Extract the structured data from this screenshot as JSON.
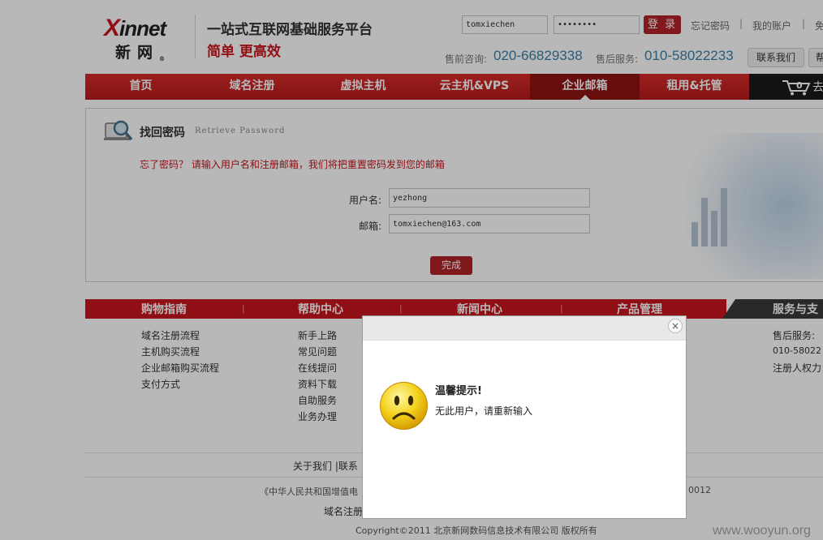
{
  "header": {
    "logo_main": "innet",
    "logo_main_x": "X",
    "logo_sub": "新网",
    "logo_reg": "®",
    "slogan_line1": "一站式互联网基础服务平台",
    "slogan_line2": "简单 更高效",
    "username_value": "tomxiechen",
    "password_value": "••••••••",
    "login_label": "登 录",
    "forgot_link": "忘记密码",
    "account_link": "我的账户",
    "link3": "免",
    "sep": "|",
    "presale_label": "售前咨询:",
    "presale_phone": "020-66829338",
    "aftersale_label": "售后服务:",
    "aftersale_phone": "010-58022233",
    "contact_button": "联系我们",
    "extra_button": "帮"
  },
  "nav": {
    "items": [
      {
        "label": "首页"
      },
      {
        "label": "域名注册"
      },
      {
        "label": "虚拟主机"
      },
      {
        "label": "云主机&VPS"
      },
      {
        "label": "企业邮箱"
      },
      {
        "label": "租用&托管"
      }
    ],
    "active_index": 4,
    "cart_count": "0",
    "cart_label": "去"
  },
  "panel": {
    "title": "找回密码",
    "title_en": "Retrieve Password",
    "tip": "忘了密码？  请输入用户名和注册邮箱，我们将把重置密码发到您的邮箱",
    "username_label": "用户名:",
    "username_value": "yezhong",
    "email_label": "邮箱:",
    "email_value": "tomxiechen@163.com",
    "submit_label": "完成"
  },
  "footer": {
    "sections": [
      {
        "title": "购物指南",
        "links": [
          "域名注册流程",
          "主机购买流程",
          "企业邮箱购买流程",
          "支付方式"
        ]
      },
      {
        "title": "帮助中心",
        "links": [
          "新手上路",
          "常见问题",
          "在线提问",
          "资料下载",
          "自助服务",
          "业务办理"
        ]
      },
      {
        "title": "新闻中心",
        "links": []
      },
      {
        "title": "产品管理",
        "links": []
      },
      {
        "title": "服务与支",
        "links": [
          "售后服务:",
          "010-58022",
          "注册人权力"
        ]
      }
    ],
    "bottom_links": "关于我们 |联系",
    "license": "《中华人民共和国增值电",
    "license_tail": "0012",
    "domain_text": "域名注册",
    "copyright": "Copyright©2011  北京新网数码信息技术有限公司  版权所有"
  },
  "modal": {
    "close_glyph": "×",
    "title": "温馨提示!",
    "message": "无此用户，请重新输入"
  },
  "watermark": "www.wooyun.org"
}
